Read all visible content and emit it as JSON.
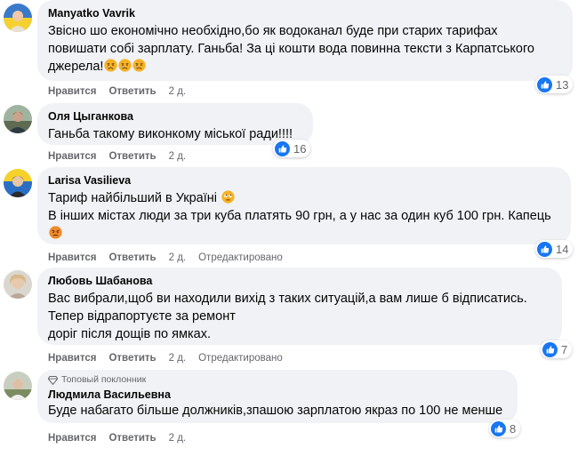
{
  "labels": {
    "like": "Нравится",
    "reply": "Ответить",
    "edited": "Отредактировано",
    "top_fan": "Топовый поклонник"
  },
  "colors": {
    "bubble": "#f0f2f5",
    "like_blue": "#1877f2",
    "meta_gray": "#65676b"
  },
  "comments": [
    {
      "author": "Manyatko Vavrik",
      "lines": [
        "Звісно шо економічно необхідно,бо як водоканал буде при старих тарифах",
        "повишати собі зарплату. Ганьба! За ці кошти вода повинна тексти з Карпатського",
        "джерела!"
      ],
      "emoji": [
        "crying-face-emoji",
        "crying-face-emoji",
        "crying-face-emoji"
      ],
      "time": "2 д.",
      "reactions": "13"
    },
    {
      "author": "Оля Цыганкова",
      "lines": [
        "Ганьба такому виконкому міської ради!!!!"
      ],
      "time": "2 д.",
      "reactions": "16"
    },
    {
      "author": "Larisa Vasilieva",
      "lines": [
        "Тариф найбільший в Україні",
        "В інших містах люди за три куба платять 90 грн, а у нас за один куб 100 грн. Капець"
      ],
      "emoji": [
        "rolling-eyes-emoji",
        "angry-face-emoji"
      ],
      "time": "2 д.",
      "edited": true,
      "reactions": "14"
    },
    {
      "author": "Любовь Шабанова",
      "lines": [
        "Вас вибрали,щоб ви находили вихід з таких ситуацій,а вам лише б відписатись.",
        "Тепер відрапортуєте за ремонт",
        "доріг після дощів по ямках."
      ],
      "time": "2 д.",
      "edited": true,
      "reactions": "7"
    },
    {
      "author": "Людмила Васильевна",
      "top_fan": true,
      "lines": [
        "Буде набагато більше должників,зпашою зарплатою якраз по 100 не менше"
      ],
      "time": "2 д.",
      "reactions": "8"
    }
  ]
}
